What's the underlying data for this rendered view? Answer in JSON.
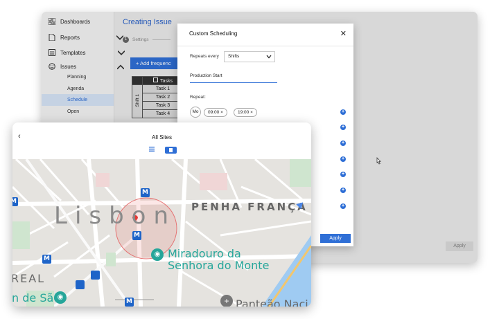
{
  "sidebar": {
    "items": [
      {
        "label": "Dashboards",
        "icon": "dashboard-icon"
      },
      {
        "label": "Reports",
        "icon": "report-icon"
      },
      {
        "label": "Templates",
        "icon": "template-icon"
      },
      {
        "label": "Issues",
        "icon": "issues-icon"
      }
    ],
    "sub_items": [
      "Planning",
      "Agenda",
      "Schedule",
      "Open"
    ],
    "active_sub": "Schedule"
  },
  "main": {
    "title": "Creating Issue",
    "step_number": "1",
    "step_label": "Settings",
    "add_button": "+ Add frequenc",
    "table": {
      "header": "Tasks",
      "shift_label": "Shift 1",
      "rows": [
        "Task 1",
        "Task 2",
        "Task 3",
        "Task 4"
      ]
    },
    "apply_label": "Apply"
  },
  "modal": {
    "title": "Custom Scheduling",
    "repeats_label": "Repeats every",
    "repeats_value": "Shifts",
    "name_value": "Production Start",
    "repeat_label": "Repeat:",
    "day": "Mo",
    "times": [
      "09:00",
      "19:00"
    ],
    "apply_label": "Apply"
  },
  "sites": {
    "title": "All Sites",
    "map_labels": {
      "city": "Lisbon",
      "district": "PENHA FRANÇA",
      "poi_1": "Miradouro da",
      "poi_2": "Senhora do Monte",
      "left_1": "REAL",
      "left_2": "n de São",
      "bottom": "Panteão Naci"
    },
    "metro_marker": "M"
  },
  "colors": {
    "accent": "#2f6fd6",
    "title_blue": "#2b62c8",
    "map_teal": "#26a69a",
    "pin_red": "#e53935"
  }
}
